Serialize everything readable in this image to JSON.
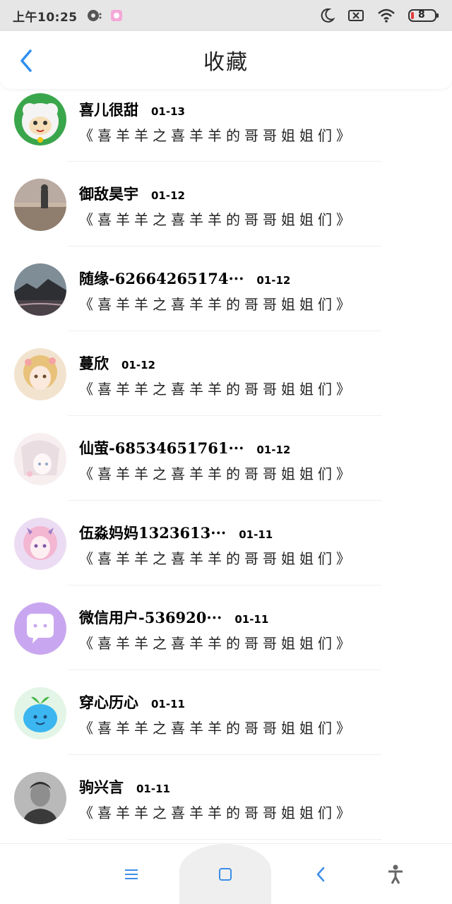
{
  "status_bar": {
    "time": "上午10:25",
    "battery": "8"
  },
  "header": {
    "title": "收藏"
  },
  "colors": {
    "accent": "#2f8ff0",
    "nav_icon": "#3b8de8"
  },
  "items": [
    {
      "name": "喜儿很甜",
      "date": "01-13",
      "subtitle": "《喜羊羊之喜羊羊的哥哥姐姐们》",
      "avatar": "sheep-cartoon"
    },
    {
      "name": "御敌昊宇",
      "date": "01-12",
      "subtitle": "《喜羊羊之喜羊羊的哥哥姐姐们》",
      "avatar": "beach-person"
    },
    {
      "name": "随缘-62664265174···",
      "date": "01-12",
      "subtitle": "《喜羊羊之喜羊羊的哥哥姐姐们》",
      "avatar": "mountain-landscape"
    },
    {
      "name": "蔓欣",
      "date": "01-12",
      "subtitle": "《喜羊羊之喜羊羊的哥哥姐姐们》",
      "avatar": "anime-girl-blonde"
    },
    {
      "name": "仙萤-68534651761···",
      "date": "01-12",
      "subtitle": "《喜羊羊之喜羊羊的哥哥姐姐们》",
      "avatar": "anime-sketch"
    },
    {
      "name": "伍淼妈妈1323613···",
      "date": "01-11",
      "subtitle": "《喜羊羊之喜羊羊的哥哥姐姐们》",
      "avatar": "anime-girl-pink"
    },
    {
      "name": "微信用户-536920···",
      "date": "01-11",
      "subtitle": "《喜羊羊之喜羊羊的哥哥姐姐们》",
      "avatar": "chat-bubble"
    },
    {
      "name": "穿心历心",
      "date": "01-11",
      "subtitle": "《喜羊羊之喜羊羊的哥哥姐姐们》",
      "avatar": "blue-sprout"
    },
    {
      "name": "驹兴言",
      "date": "01-11",
      "subtitle": "《喜羊羊之喜羊羊的哥哥姐姐们》",
      "avatar": "man-photo"
    }
  ]
}
